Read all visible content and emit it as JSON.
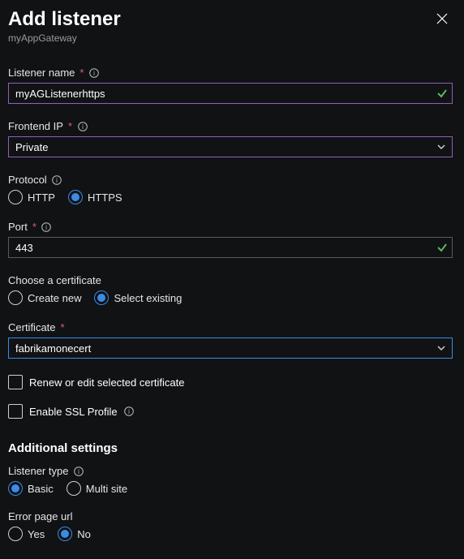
{
  "header": {
    "title": "Add listener",
    "subtitle": "myAppGateway"
  },
  "listener_name": {
    "label": "Listener name",
    "required": "*",
    "value": "myAGListenerhttps"
  },
  "frontend_ip": {
    "label": "Frontend IP",
    "required": "*",
    "value": "Private"
  },
  "protocol": {
    "label": "Protocol",
    "options": {
      "http": "HTTP",
      "https": "HTTPS"
    }
  },
  "port": {
    "label": "Port",
    "required": "*",
    "value": "443"
  },
  "choose_cert": {
    "label": "Choose a certificate",
    "options": {
      "create_new": "Create new",
      "select_existing": "Select existing"
    }
  },
  "certificate": {
    "label": "Certificate",
    "required": "*",
    "value": "fabrikamonecert"
  },
  "renew_cert": "Renew or edit selected certificate",
  "enable_ssl": "Enable SSL Profile",
  "additional": {
    "title": "Additional settings",
    "listener_type": {
      "label": "Listener type",
      "options": {
        "basic": "Basic",
        "multi": "Multi site"
      }
    },
    "error_page": {
      "label": "Error page url",
      "options": {
        "yes": "Yes",
        "no": "No"
      }
    }
  }
}
